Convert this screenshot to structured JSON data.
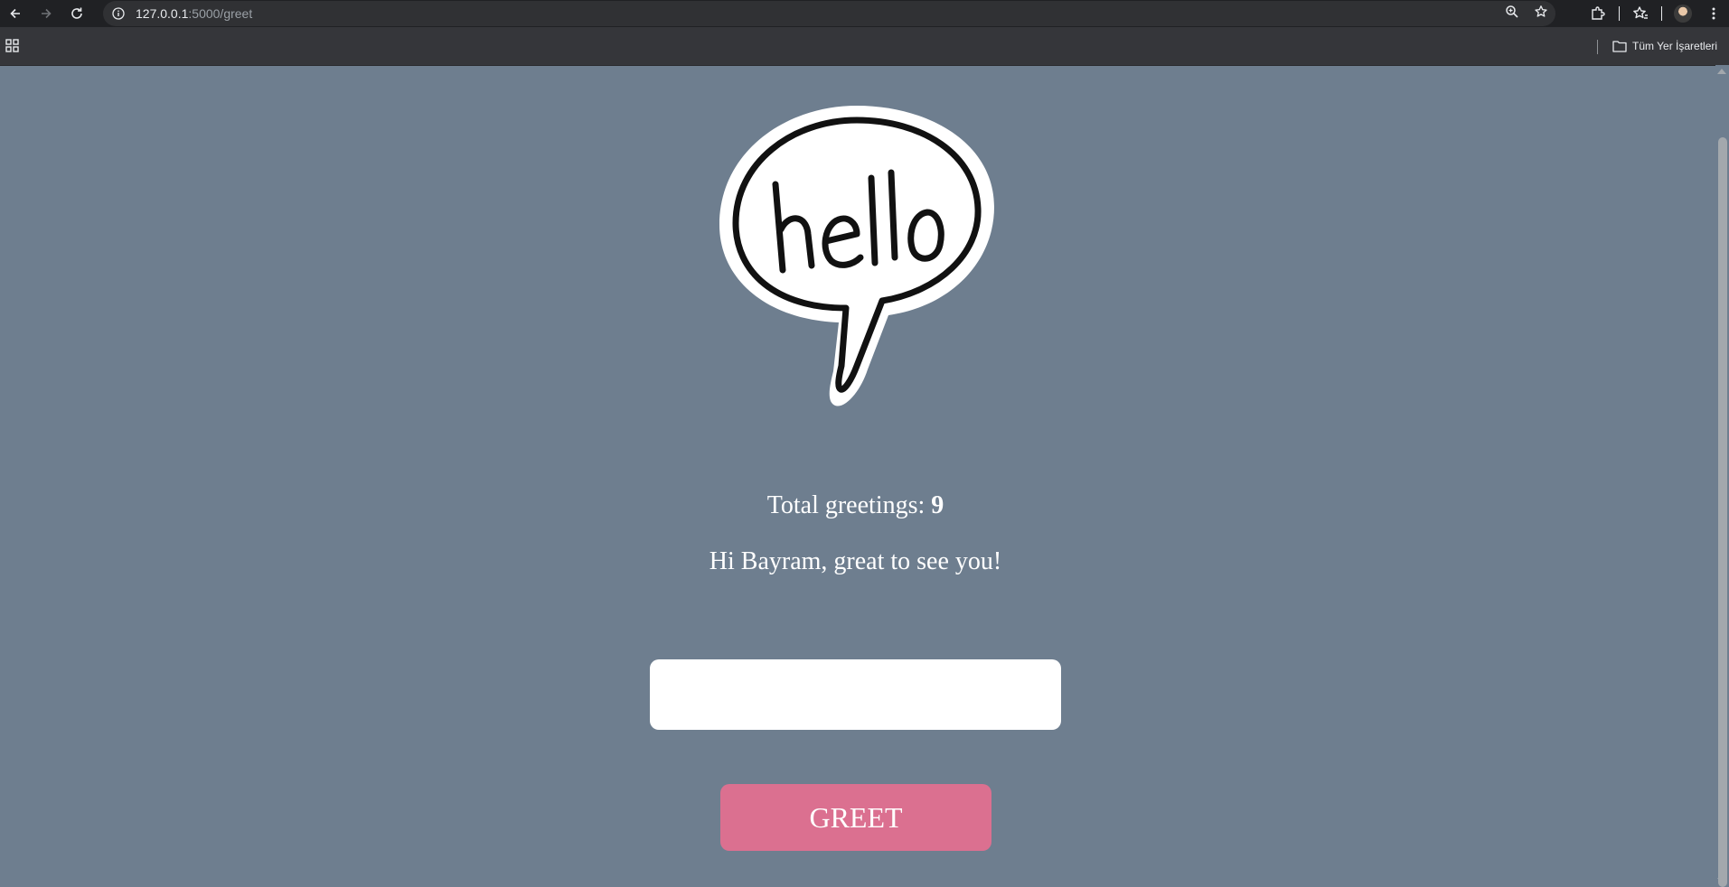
{
  "browser": {
    "url_host": "127.0.0.1",
    "url_path": ":5000/greet",
    "bookmarks_all_label": "Tüm Yer İşaretleri"
  },
  "page": {
    "image_text": "hello",
    "total_label": "Total greetings: ",
    "total_count": "9",
    "message": "Hi Bayram, great to see you!",
    "input_value": "",
    "button_label": "GREET"
  },
  "colors": {
    "background": "#6e7e8f",
    "button": "#db7090",
    "text": "#ffffff"
  }
}
